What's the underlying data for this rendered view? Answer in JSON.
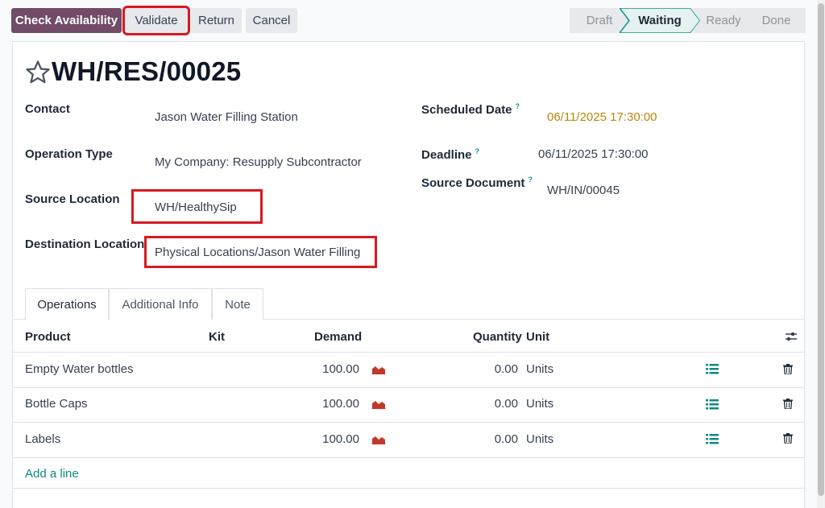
{
  "toolbar": {
    "check_availability": "Check Availability",
    "validate": "Validate",
    "return": "Return",
    "cancel": "Cancel"
  },
  "status": {
    "stages": [
      "Draft",
      "Waiting",
      "Ready",
      "Done"
    ],
    "active": "Waiting"
  },
  "record": {
    "title": "WH/RES/00025",
    "contact_label": "Contact",
    "contact": "Jason Water Filling Station",
    "operation_type_label": "Operation Type",
    "operation_type": "My Company: Resupply Subcontractor",
    "source_location_label": "Source Location",
    "source_location": "WH/HealthySip",
    "destination_location_label": "Destination Location",
    "destination_location": "Physical Locations/Jason Water Filling Station",
    "scheduled_date_label": "Scheduled Date",
    "scheduled_date": "06/11/2025 17:30:00",
    "deadline_label": "Deadline",
    "deadline": "06/11/2025 17:30:00",
    "source_document_label": "Source Document",
    "source_document": "WH/IN/00045",
    "help_mark": "?"
  },
  "tabs": [
    "Operations",
    "Additional Info",
    "Note"
  ],
  "table": {
    "headers": {
      "product": "Product",
      "kit": "Kit",
      "demand": "Demand",
      "quantity": "Quantity",
      "unit": "Unit"
    },
    "rows": [
      {
        "product": "Empty Water bottles",
        "demand": "100.00",
        "quantity": "0.00",
        "unit": "Units"
      },
      {
        "product": "Bottle Caps",
        "demand": "100.00",
        "quantity": "0.00",
        "unit": "Units"
      },
      {
        "product": "Labels",
        "demand": "100.00",
        "quantity": "0.00",
        "unit": "Units"
      }
    ],
    "add_line": "Add a line"
  },
  "colors": {
    "primary": "#714b67",
    "highlight": "#d71920",
    "scheduled_date": "#b8860b",
    "link": "#0f8a7e",
    "chart_icon": "#c0392b"
  },
  "icons": {
    "favorite": "star-icon",
    "forecast": "area-chart-icon",
    "details": "list-icon",
    "delete": "trash-icon",
    "optional_columns": "sliders-icon"
  }
}
